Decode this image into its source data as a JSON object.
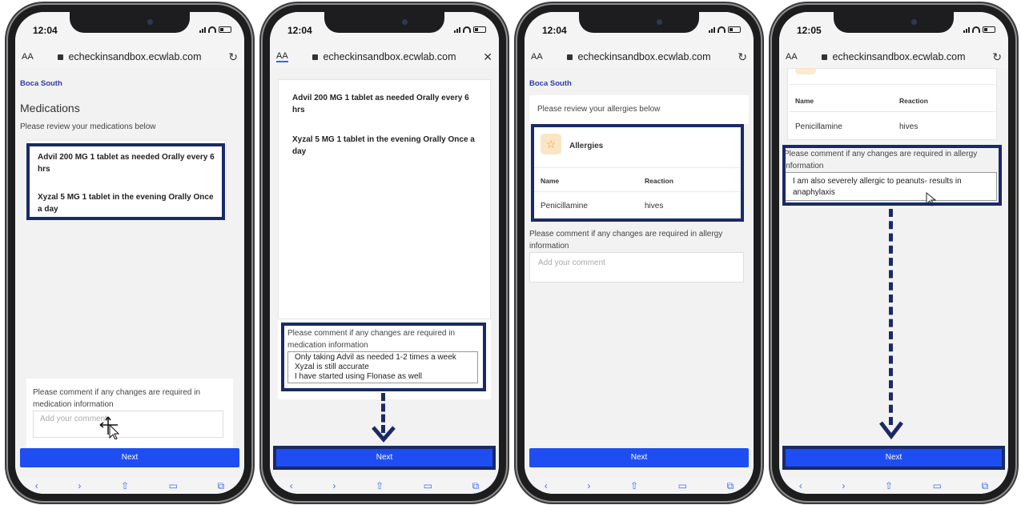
{
  "status": {
    "time_1": "12:04",
    "time_2": "12:04",
    "time_3": "12:04",
    "time_4": "12:05"
  },
  "browser": {
    "aa_label": "AA",
    "url": "echeckinsandbox.ecwlab.com"
  },
  "common": {
    "location": "Boca South",
    "next_label": "Next"
  },
  "screen1": {
    "title": "Medications",
    "subtitle": "Please review your medications below",
    "med1": "Advil 200 MG 1 tablet as needed Orally every 6 hrs",
    "med2": "Xyzal 5 MG 1 tablet in the evening Orally Once a day",
    "comment_label": "Please comment if any changes are required in medication information",
    "comment_placeholder": "Add your comment"
  },
  "screen2": {
    "med1": "Advil 200 MG 1 tablet as needed Orally every 6 hrs",
    "med2": "Xyzal 5 MG 1 tablet in the evening Orally Once a day",
    "comment_label": "Please comment if any changes are required in medication information",
    "comment_line1": "Only taking Advil as needed 1-2 times a week",
    "comment_line2": "Xyzal is still accurate",
    "comment_line3": "I have started using Flonase as well"
  },
  "screen3": {
    "subtitle": "Please review your allergies below",
    "card_title": "Allergies",
    "col_name": "Name",
    "col_reaction": "Reaction",
    "row_name": "Penicillamine",
    "row_reaction": "hives",
    "comment_label": "Please comment if any changes are required in allergy information",
    "comment_placeholder": "Add your comment"
  },
  "screen4": {
    "col_name": "Name",
    "col_reaction": "Reaction",
    "row_name": "Penicillamine",
    "row_reaction": "hives",
    "comment_label": "Please comment if any changes are required in allergy information",
    "comment_value": "I am also severely allergic to peanuts- results in anaphylaxis"
  },
  "colors": {
    "accent": "#1e4ef2",
    "highlight": "#1a2a66",
    "location": "#2f3ba8"
  },
  "icons": [
    "reload-icon",
    "close-icon",
    "lock-icon",
    "star-icon",
    "arrow-down-icon",
    "cursor-icon",
    "share-icon",
    "bookmarks-icon",
    "tabs-icon"
  ]
}
